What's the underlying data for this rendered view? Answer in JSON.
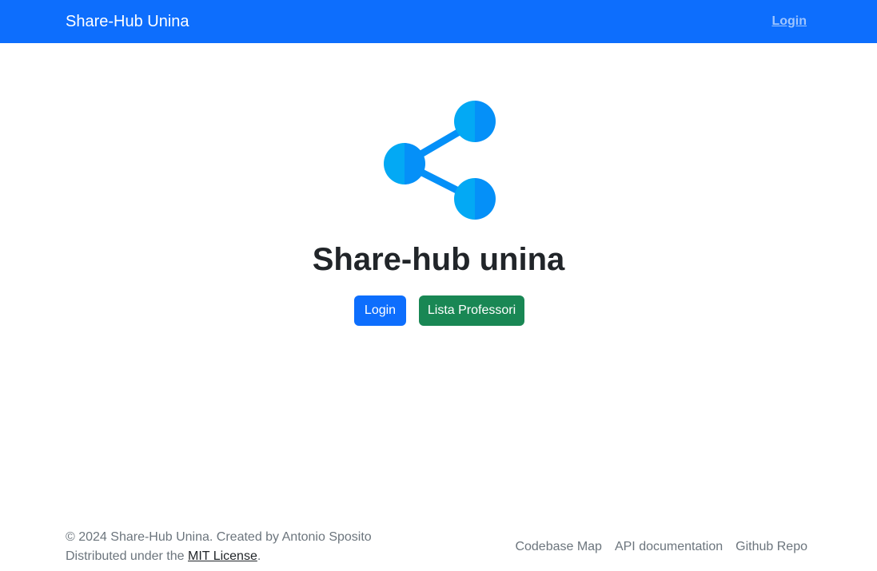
{
  "navbar": {
    "brand": "Share-Hub Unina",
    "login_link": "Login",
    "bg_color": "#0d6efd"
  },
  "hero": {
    "icon": "share-icon",
    "title": "Share-hub unina",
    "buttons": {
      "login": "Login",
      "professors": "Lista Professori"
    },
    "colors": {
      "primary": "#0d6efd",
      "success": "#198754",
      "icon_light": "#03a9f4",
      "icon_dark": "#0590f8"
    }
  },
  "footer": {
    "copyright": "© 2024 Share-Hub Unina. Created by Antonio Sposito",
    "license_prefix": "Distributed under the ",
    "license_link": "MIT License",
    "license_suffix": ".",
    "links": [
      "Codebase Map",
      "API documentation",
      "Github Repo"
    ]
  }
}
